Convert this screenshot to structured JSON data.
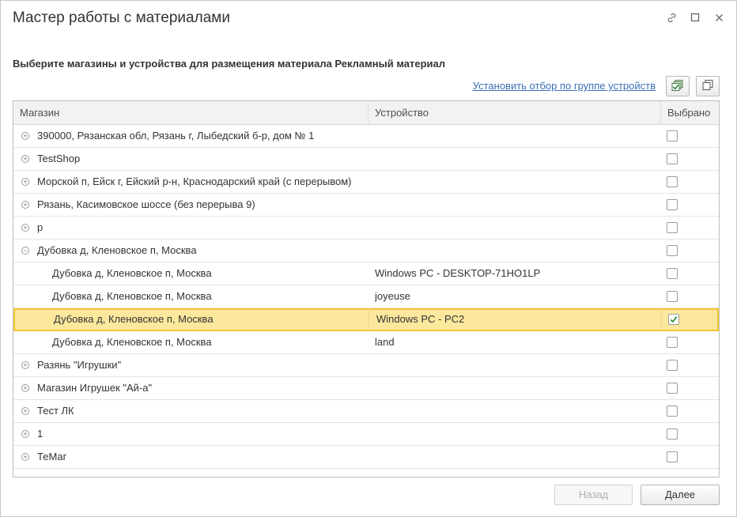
{
  "window": {
    "title": "Мастер работы с материалами",
    "icons": [
      "link-icon",
      "maximize-icon",
      "close-icon"
    ]
  },
  "subtitle": "Выберите магазины и устройства для размещения материала Рекламный материал",
  "toolbar": {
    "filter_link": "Установить отбор по группе устройств",
    "btn1_icon": "select-all-icon",
    "btn2_icon": "copy-icon"
  },
  "table": {
    "headers": {
      "shop": "Магазин",
      "device": "Устройство",
      "selected": "Выбрано"
    },
    "rows": [
      {
        "shop": "390000, Рязанская обл, Рязань г, Лыбедский б-р, дом № 1",
        "device": "",
        "type": "group",
        "expanded": false,
        "checked": false
      },
      {
        "shop": "TestShop",
        "device": "",
        "type": "group",
        "expanded": false,
        "checked": false
      },
      {
        "shop": "Морской п, Ейск г, Ейский р-н, Краснодарский край (с перерывом)",
        "device": "",
        "type": "group",
        "expanded": false,
        "checked": false
      },
      {
        "shop": "Рязань, Касимовское шоссе (без перерыва 9)",
        "device": "",
        "type": "group",
        "expanded": false,
        "checked": false
      },
      {
        "shop": "р",
        "device": "",
        "type": "group",
        "expanded": false,
        "checked": false
      },
      {
        "shop": "Дубовка д, Кленовское п, Москва",
        "device": "",
        "type": "group",
        "expanded": true,
        "checked": false
      },
      {
        "shop": "Дубовка д, Кленовское п, Москва",
        "device": "Windows PC - DESKTOP-71HO1LP",
        "type": "child",
        "checked": false
      },
      {
        "shop": "Дубовка д, Кленовское п, Москва",
        "device": "joyeuse",
        "type": "child",
        "checked": false
      },
      {
        "shop": "Дубовка д, Кленовское п, Москва",
        "device": "Windows PC - PC2",
        "type": "child",
        "checked": true,
        "selected": true
      },
      {
        "shop": "Дубовка д, Кленовское п, Москва",
        "device": "land",
        "type": "child",
        "checked": false
      },
      {
        "shop": "Разянь \"Игрушки\"",
        "device": "",
        "type": "group",
        "expanded": false,
        "checked": false
      },
      {
        "shop": "Магазин Игрушек \"Ай-а\"",
        "device": "",
        "type": "group",
        "expanded": false,
        "checked": false
      },
      {
        "shop": "Тест ЛК",
        "device": "",
        "type": "group",
        "expanded": false,
        "checked": false
      },
      {
        "shop": "1",
        "device": "",
        "type": "group",
        "expanded": false,
        "checked": false
      },
      {
        "shop": "ТеМаг",
        "device": "",
        "type": "group",
        "expanded": false,
        "checked": false
      }
    ]
  },
  "buttons": {
    "back": "Назад",
    "next": "Далее"
  },
  "colors": {
    "selection_bg": "#fce89d",
    "selection_border": "#f4c531",
    "link": "#3a6fb5",
    "check": "#2e8b3a"
  }
}
